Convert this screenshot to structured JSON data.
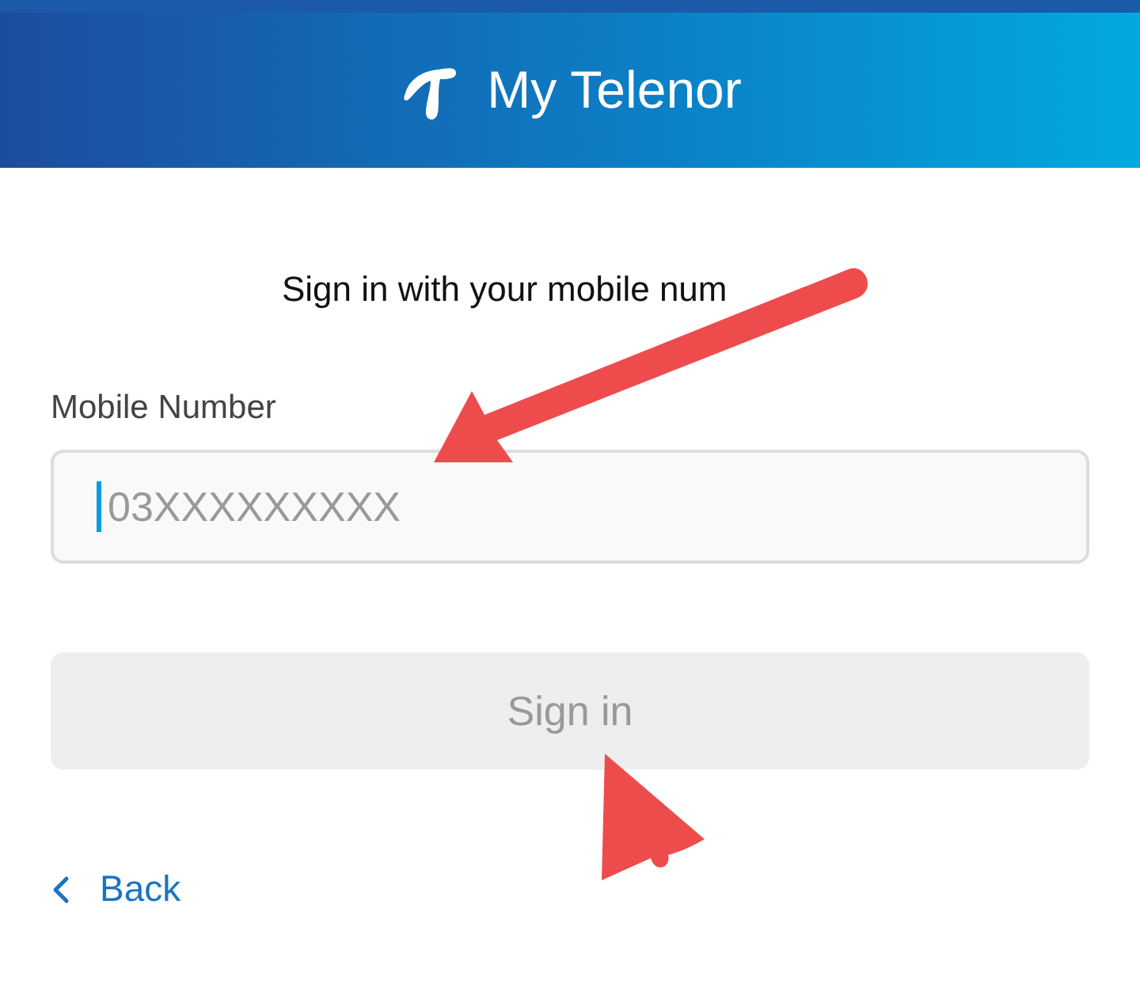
{
  "header": {
    "title": "My Telenor"
  },
  "subtitle": "Sign in with your mobile num",
  "mobile_field": {
    "label": "Mobile Number",
    "placeholder": "03XXXXXXXXX",
    "focused": true
  },
  "sign_in_button": {
    "label": "Sign in",
    "disabled": true
  },
  "back_link": {
    "label": "Back"
  }
}
